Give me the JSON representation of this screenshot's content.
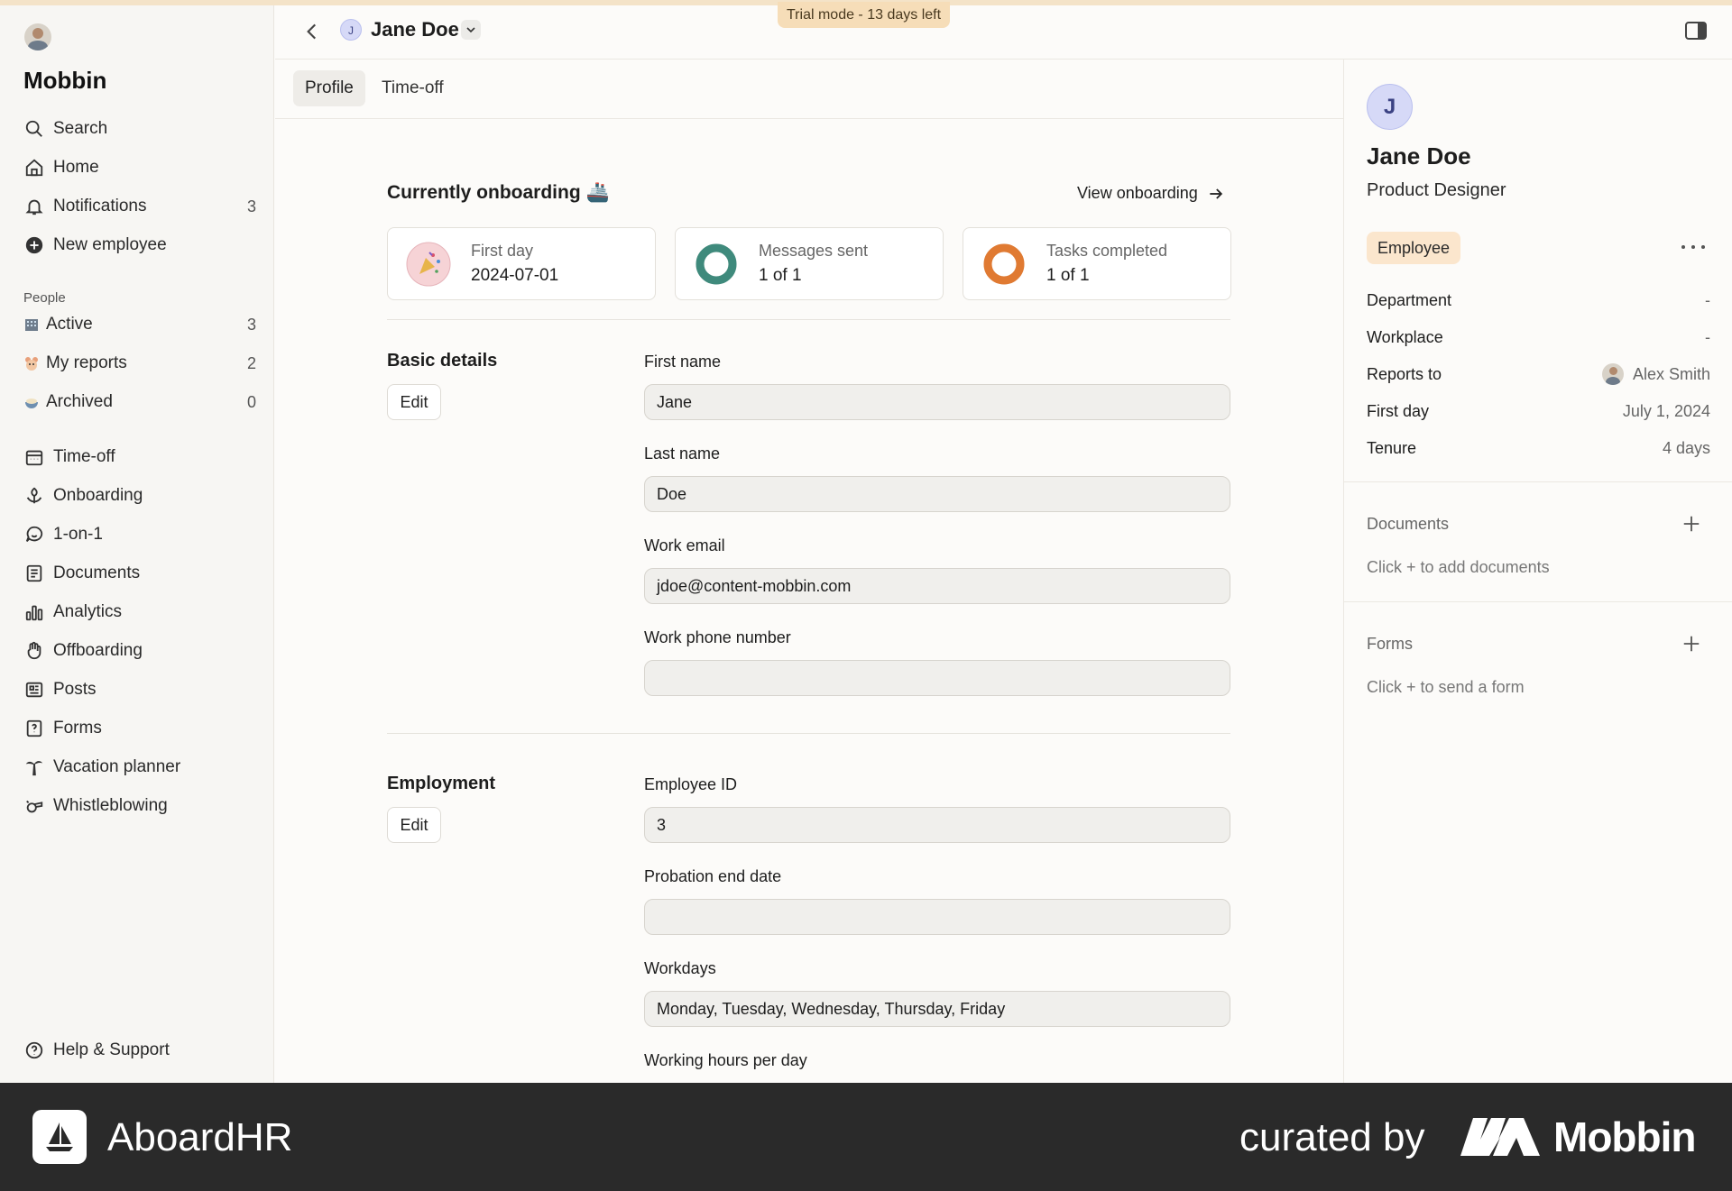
{
  "trial_badge": "Trial mode - 13 days left",
  "sidebar": {
    "brand": "Mobbin",
    "top_items": [
      {
        "label": "Search",
        "icon": "search-icon"
      },
      {
        "label": "Home",
        "icon": "home-icon"
      },
      {
        "label": "Notifications",
        "icon": "bell-icon",
        "count": "3"
      },
      {
        "label": "New employee",
        "icon": "plus-circle-icon"
      }
    ],
    "people_label": "People",
    "people_items": [
      {
        "label": "Active",
        "icon": "building-emoji-icon",
        "count": "3"
      },
      {
        "label": "My reports",
        "icon": "hamster-emoji-icon",
        "count": "2"
      },
      {
        "label": "Archived",
        "icon": "bowl-emoji-icon",
        "count": "0"
      }
    ],
    "tool_items": [
      {
        "label": "Time-off",
        "icon": "calendar-icon"
      },
      {
        "label": "Onboarding",
        "icon": "flower-icon"
      },
      {
        "label": "1-on-1",
        "icon": "chat-smile-icon"
      },
      {
        "label": "Documents",
        "icon": "document-icon"
      },
      {
        "label": "Analytics",
        "icon": "bar-chart-icon"
      },
      {
        "label": "Offboarding",
        "icon": "wave-hand-icon"
      },
      {
        "label": "Posts",
        "icon": "newspaper-icon"
      },
      {
        "label": "Forms",
        "icon": "form-question-icon"
      },
      {
        "label": "Vacation planner",
        "icon": "palm-tree-icon"
      },
      {
        "label": "Whistleblowing",
        "icon": "whistle-icon"
      }
    ],
    "help": "Help & Support"
  },
  "header": {
    "avatar_initial": "J",
    "name": "Jane Doe"
  },
  "tabs": [
    {
      "label": "Profile",
      "active": true
    },
    {
      "label": "Time-off",
      "active": false
    }
  ],
  "onboarding": {
    "title": "Currently onboarding 🚢",
    "view_link": "View onboarding",
    "cards": [
      {
        "label": "First day",
        "value": "2024-07-01",
        "icon": "party-popper-icon"
      },
      {
        "label": "Messages sent",
        "value": "1 of 1",
        "icon": "progress-ring-icon",
        "progress": 1.0,
        "color": "#3f8a7c"
      },
      {
        "label": "Tasks completed",
        "value": "1 of 1",
        "icon": "progress-ring-icon",
        "progress": 1.0,
        "color": "#e07a32"
      }
    ]
  },
  "basic_details": {
    "title": "Basic details",
    "edit": "Edit",
    "fields": [
      {
        "label": "First name",
        "value": "Jane"
      },
      {
        "label": "Last name",
        "value": "Doe"
      },
      {
        "label": "Work email",
        "value": "jdoe@content-mobbin.com"
      },
      {
        "label": "Work phone number",
        "value": ""
      }
    ]
  },
  "employment": {
    "title": "Employment",
    "edit": "Edit",
    "fields": [
      {
        "label": "Employee ID",
        "value": "3"
      },
      {
        "label": "Probation end date",
        "value": ""
      },
      {
        "label": "Workdays",
        "value": "Monday, Tuesday, Wednesday, Thursday, Friday"
      },
      {
        "label": "Working hours per day",
        "value": ""
      }
    ]
  },
  "profile_panel": {
    "avatar_initial": "J",
    "name": "Jane Doe",
    "role": "Product Designer",
    "badge": "Employee",
    "details": [
      {
        "key": "Department",
        "value": "-"
      },
      {
        "key": "Workplace",
        "value": "-"
      },
      {
        "key": "Reports to",
        "value": "Alex Smith"
      },
      {
        "key": "First day",
        "value": "July 1, 2024"
      },
      {
        "key": "Tenure",
        "value": "4 days"
      }
    ],
    "documents_title": "Documents",
    "documents_hint": "Click + to add documents",
    "forms_title": "Forms",
    "forms_hint": "Click + to send a form"
  },
  "footer": {
    "app_name": "AboardHR",
    "curated_by": "curated by",
    "brand": "Mobbin"
  },
  "colors": {
    "accent_teal": "#3f8a7c",
    "accent_orange": "#e07a32",
    "badge_bg": "#fbe6cd",
    "avatar_bg": "#d6d9f7"
  }
}
